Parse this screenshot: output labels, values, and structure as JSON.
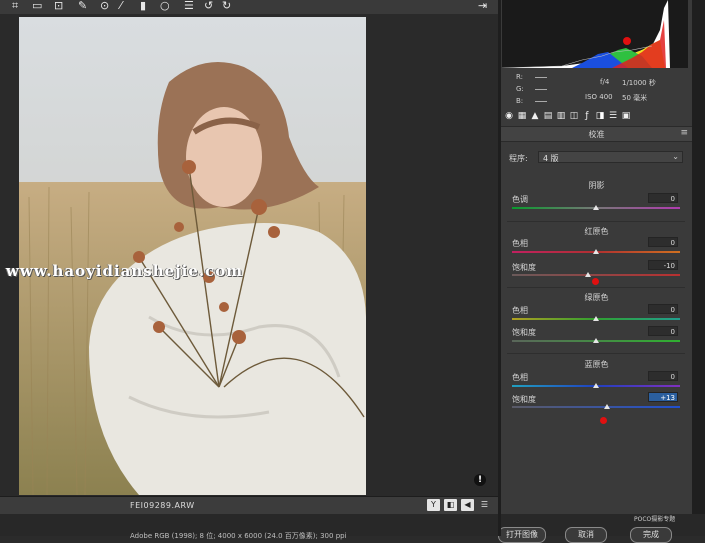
{
  "toolbar": {
    "icons": [
      "crop-icon",
      "straighten-icon",
      "transform-icon",
      "spot-removal-icon",
      "redeye-icon",
      "brush-icon",
      "graduated-filter-icon",
      "radial-filter-icon",
      "list-icon",
      "rotate-left-icon",
      "rotate-right-icon",
      "export-icon"
    ]
  },
  "photo": {
    "watermark": "www.haoyidianshejie.com",
    "warning_glyph": "!"
  },
  "statusbar": {
    "filename": "FEI09289.ARW",
    "buttons": [
      "Y",
      "◧",
      "◀",
      "☰"
    ],
    "image_info": "Adobe RGB (1998); 8 位; 4000 x 6000 (24.0 百万像素); 300 ppi",
    "open_button": "打开图像",
    "cancel_button": "取消",
    "done_button": "完成",
    "brand": "POCO摄影专题"
  },
  "histogram": {
    "labels": {
      "r": "R:",
      "g": "G:",
      "b": "B:"
    },
    "aperture": "f/4",
    "shutter": "1/1000 秒",
    "iso": "ISO 400",
    "focal": "50 毫米"
  },
  "panel": {
    "title": "校准",
    "process_label": "程序:",
    "process_value": "4 版",
    "sections": [
      {
        "header": "阴影",
        "rows": [
          {
            "label": "色调",
            "value": "0",
            "pos": 0.5,
            "track": "shadow-tint"
          }
        ]
      },
      {
        "header": "红原色",
        "rows": [
          {
            "label": "色相",
            "value": "0",
            "pos": 0.5,
            "track": "red-hue"
          },
          {
            "label": "饱和度",
            "value": "-10",
            "pos": 0.45,
            "track": "red-sat"
          }
        ]
      },
      {
        "header": "绿原色",
        "rows": [
          {
            "label": "色相",
            "value": "0",
            "pos": 0.5,
            "track": "green-hue"
          },
          {
            "label": "饱和度",
            "value": "0",
            "pos": 0.5,
            "track": "green-sat"
          }
        ]
      },
      {
        "header": "蓝原色",
        "rows": [
          {
            "label": "色相",
            "value": "0",
            "pos": 0.5,
            "track": "blue-hue"
          },
          {
            "label": "饱和度",
            "value": "+13",
            "pos": 0.57,
            "track": "blue-sat"
          }
        ]
      }
    ]
  },
  "colors": {
    "accent": "#2b5f9e",
    "marker": "#e01010"
  }
}
